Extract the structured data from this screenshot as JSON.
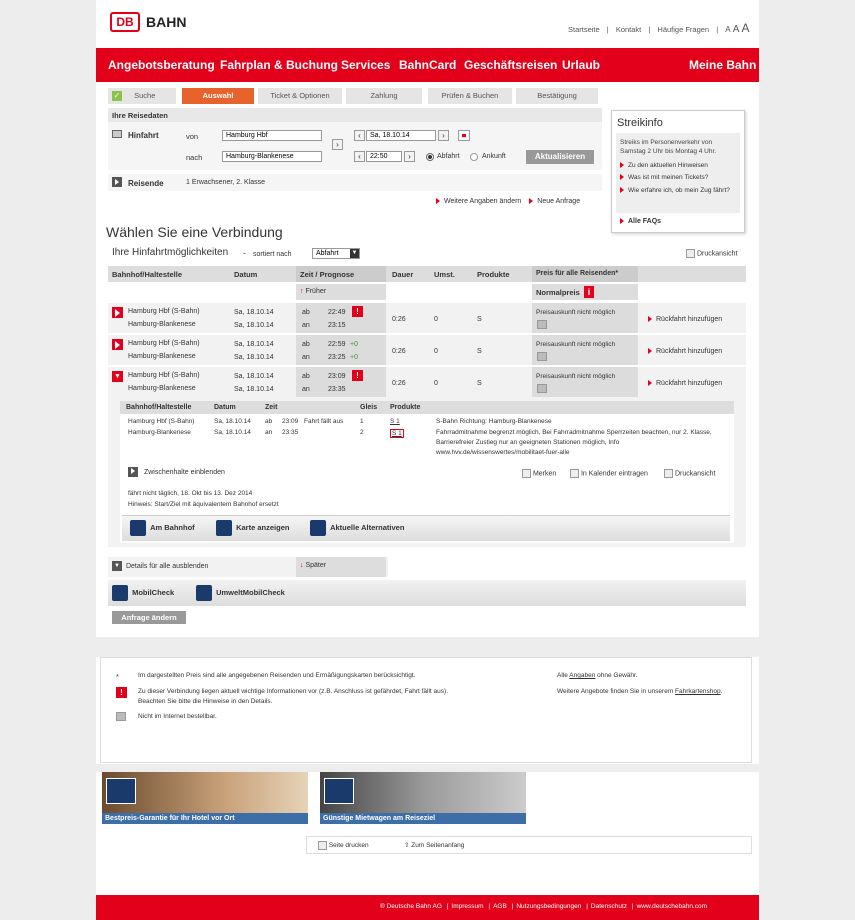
{
  "header": {
    "logo_db": "DB",
    "logo_bahn": "BAHN",
    "links": [
      "Startseite",
      "Kontakt",
      "Häufige Fragen"
    ],
    "font_sizes": [
      "A",
      "A",
      "A"
    ]
  },
  "nav": {
    "items": [
      "Angebotsberatung",
      "Fahrplan & Buchung",
      "Services",
      "BahnCard",
      "Geschäftsreisen",
      "Urlaub"
    ],
    "right": "Meine Bahn"
  },
  "steps": [
    "Suche",
    "Auswahl",
    "Ticket & Optionen",
    "Zahlung",
    "Prüfen & Buchen",
    "Bestätigung"
  ],
  "reise": {
    "title": "Ihre Reisedaten",
    "hinfahrt": "Hinfahrt",
    "von_label": "von",
    "nach_label": "nach",
    "von": "Hamburg Hbf",
    "nach": "Hamburg-Blankenese",
    "date": "Sa, 18.10.14",
    "time": "22:50",
    "abfahrt": "Abfahrt",
    "ankunft": "Ankunft",
    "aktualisieren": "Aktualisieren",
    "reisende_label": "Reisende",
    "reisende_value": "1 Erwachsener, 2. Klasse",
    "weitere": "Weitere Angaben ändern",
    "neue": "Neue Anfrage"
  },
  "streik": {
    "title": "Streikinfo",
    "text": "Streiks im Personenverkehr von Samstag 2 Uhr bis Montag 4 Uhr.",
    "links": [
      "Zu den aktuellen Hinweisen",
      "Was ist mit meinen Tickets?",
      "Wie erfahre ich, ob mein Zug fährt?"
    ],
    "faq": "Alle FAQs"
  },
  "results": {
    "heading": "Wählen Sie eine Verbindung",
    "sub": "Ihre Hinfahrtmöglichkeiten",
    "dash": "-",
    "sort_label": "sortiert nach",
    "sort_value": "Abfahrt",
    "druck": "Druckansicht",
    "cols": [
      "Bahnhof/Haltestelle",
      "Datum",
      "Zeit / Prognose",
      "Dauer",
      "Umst.",
      "Produkte",
      "Preis für alle Reisenden*"
    ],
    "frueher": "Früher",
    "normalpreis": "Normalpreis",
    "info_i": "i",
    "rows": [
      {
        "from": "Hamburg Hbf (S-Bahn)",
        "to": "Hamburg-Blankenese",
        "d1": "Sa, 18.10.14",
        "d2": "Sa, 18.10.14",
        "ab": "ab",
        "an": "an",
        "t1": "22:49",
        "t2": "23:15",
        "p1": "",
        "p2": "",
        "dauer": "0:26",
        "umst": "0",
        "prod": "S",
        "price": "Preisauskunft nicht möglich",
        "rueck": "Rückfahrt hinzufügen",
        "warn": true
      },
      {
        "from": "Hamburg Hbf (S-Bahn)",
        "to": "Hamburg-Blankenese",
        "d1": "Sa, 18.10.14",
        "d2": "Sa, 18.10.14",
        "ab": "ab",
        "an": "an",
        "t1": "22:59",
        "t2": "23:25",
        "p1": "+0",
        "p2": "+0",
        "dauer": "0:26",
        "umst": "0",
        "prod": "S",
        "price": "Preisauskunft nicht möglich",
        "rueck": "Rückfahrt hinzufügen",
        "warn": false
      },
      {
        "from": "Hamburg Hbf (S-Bahn)",
        "to": "Hamburg-Blankenese",
        "d1": "Sa, 18.10.14",
        "d2": "Sa, 18.10.14",
        "ab": "ab",
        "an": "an",
        "t1": "23:09",
        "t2": "23:35",
        "p1": "",
        "p2": "",
        "dauer": "0:26",
        "umst": "0",
        "prod": "S",
        "price": "Preisauskunft nicht möglich",
        "rueck": "Rückfahrt hinzufügen",
        "warn": true
      }
    ],
    "detail": {
      "cols": [
        "Bahnhof/Haltestelle",
        "Datum",
        "Zeit",
        "Gleis",
        "Produkte"
      ],
      "r1": {
        "st": "Hamburg Hbf (S-Bahn)",
        "d": "Sa, 18.10.14",
        "ab": "ab",
        "t": "23:09",
        "warn": "Fahrt fällt aus",
        "g": "1",
        "p": "S 1"
      },
      "r2": {
        "st": "Hamburg-Blankenese",
        "d": "Sa, 18.10.14",
        "ab": "an",
        "t": "23:35",
        "g": "2",
        "p": "S 1"
      },
      "info1": "S-Bahn Richtung: Hamburg-Blankenese",
      "info2": "Fahrradmitnahme begrenzt möglich, Bei Fahrradmitnahme Sperrzeiten beachten, nur 2. Klasse, Barrierefreier Zustieg nur an geeigneten Stationen möglich, Info www.hvv.de/wissenswertes/mobilitaet-fuer-alle",
      "zwischen": "Zwischenhalte einblenden",
      "merken": "Merken",
      "kalender": "In Kalender eintragen",
      "druck": "Druckansicht",
      "note1": "fährt nicht täglich, 18. Okt bis 13. Dez 2014",
      "note2": "Hinweis: Start/Ziel mit äquivalentem Bahnhof ersetzt",
      "actions": [
        "Am Bahnhof",
        "Karte anzeigen",
        "Aktuelle Alternativen"
      ]
    },
    "hide_all": "Details für alle ausblenden",
    "spaeter": "Später",
    "mobil": "MobilCheck",
    "umwelt": "UmweltMobilCheck",
    "anfrage": "Anfrage ändern"
  },
  "legend": {
    "star": "*",
    "l1": "Im dargestellten Preis sind alle angegebenen Reisenden und Ermäßigungskarten berücksichtigt.",
    "l2a": "Zu dieser Verbindung liegen aktuell wichtige Informationen vor (z.B. Anschluss ist gefährdet, Fahrt fällt aus).",
    "l2b": "Beachten Sie bitte die Hinweise in den Details.",
    "l3": "Nicht im Internet bestellbar.",
    "r1a": "Alle",
    "r1b": "Angaben",
    "r1c": "ohne Gewähr.",
    "r2a": "Weitere Angebote finden Sie in unserem",
    "r2b": "Fahrkartenshop",
    "r2c": "."
  },
  "promos": [
    "Bestpreis-Garantie für Ihr Hotel vor Ort",
    "Günstige Mietwagen am Reiseziel"
  ],
  "print": {
    "druck": "Seite drucken",
    "top": "Zum Seitenanfang"
  },
  "footer": [
    "® Deutsche Bahn AG",
    "Impressum",
    "AGB",
    "Nutzungsbedingungen",
    "Datenschutz",
    "www.deutschebahn.com"
  ]
}
